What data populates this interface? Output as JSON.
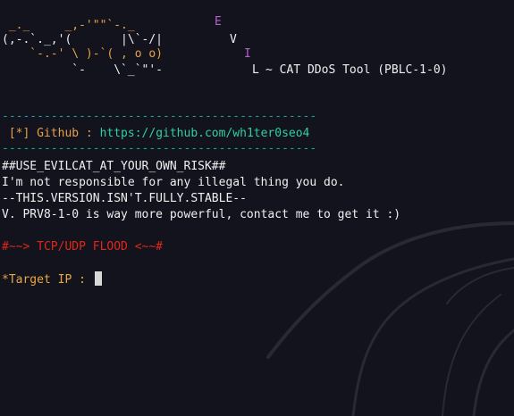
{
  "banner": {
    "art_line_1": " _._     _,-'\"\"`-._",
    "art_line_2": "(,-.`._,'(       |\\`-/|",
    "art_line_3": "    `-.-' \\ )-`( , o o)",
    "art_line_4": "          `-    \\`_`\"'-",
    "letter_e": "E",
    "letter_v": "V",
    "letter_i": "I",
    "letter_l": "L",
    "tool_name": "~ CAT DDoS Tool (PBLC-1-0)"
  },
  "info": {
    "separator": "---------------------------------------------",
    "github_prefix": " [*] Github : ",
    "github_url": "https://github.com/wh1ter0seo4"
  },
  "notice": {
    "line_1": "##USE_EVILCAT_AT_YOUR_OWN_RISK##",
    "line_2": "I'm not responsible for any illegal thing you do.",
    "line_3": "--THIS.VERSION.ISN'T.FULLY.STABLE--",
    "line_4": "V. PRV8-1-0 is way more powerful, contact me to get it :)"
  },
  "mode_header": "#~~> TCP/UDP FLOOD <~~#",
  "prompt": {
    "label": "*Target IP : ",
    "input_value": ""
  },
  "colors": {
    "background": "#12131c",
    "art": "#e8a04c",
    "letters": "#b860d0",
    "separator": "#1aa39a",
    "link": "#2fd0a0",
    "warning": "#e2261a",
    "prompt": "#e8a843"
  }
}
